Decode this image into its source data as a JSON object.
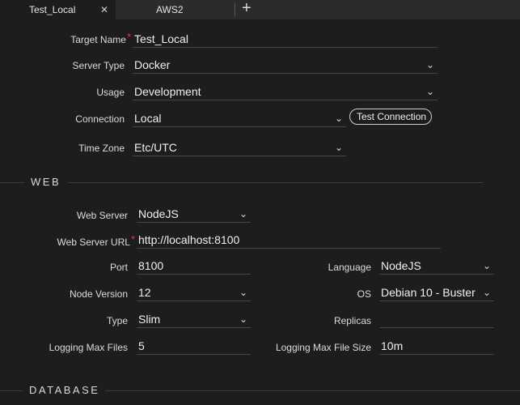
{
  "tabs": [
    {
      "label": "Test_Local",
      "close_glyph": "✕",
      "active": true
    },
    {
      "label": "AWS2",
      "active": false
    }
  ],
  "add_tab_glyph": "+",
  "form": {
    "target_name": {
      "label": "Target Name",
      "value": "Test_Local",
      "required_mark": "*"
    },
    "server_type": {
      "label": "Server Type",
      "value": "Docker"
    },
    "usage": {
      "label": "Usage",
      "value": "Development"
    },
    "connection": {
      "label": "Connection",
      "value": "Local",
      "test_button": "Test Connection"
    },
    "time_zone": {
      "label": "Time Zone",
      "value": "Etc/UTC"
    }
  },
  "sections": {
    "web": "WEB",
    "database": "DATABASE"
  },
  "web": {
    "web_server": {
      "label": "Web Server",
      "value": "NodeJS"
    },
    "web_server_url": {
      "label": "Web Server URL",
      "value": "http://localhost:8100",
      "required_mark": "*"
    },
    "port": {
      "label": "Port",
      "value": "8100"
    },
    "language": {
      "label": "Language",
      "value": "NodeJS"
    },
    "node_version": {
      "label": "Node Version",
      "value": "12"
    },
    "os": {
      "label": "OS",
      "value": "Debian 10 - Buster"
    },
    "type": {
      "label": "Type",
      "value": "Slim"
    },
    "replicas": {
      "label": "Replicas",
      "value": ""
    },
    "logging_max_files": {
      "label": "Logging Max Files",
      "value": "5"
    },
    "logging_max_file_size": {
      "label": "Logging Max File Size",
      "value": "10m"
    }
  },
  "icons": {
    "dropdown": "chevron-down-icon",
    "close": "close-icon",
    "add": "plus-icon"
  },
  "colors": {
    "background": "#1d1d1d",
    "tabbar": "#2b2b2b",
    "required": "#e23b3b"
  }
}
